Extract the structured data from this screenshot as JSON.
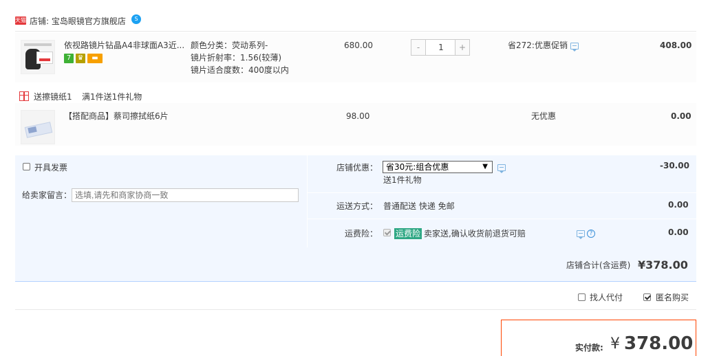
{
  "shop": {
    "badge": "天猫",
    "label": "店铺: 宝岛眼镜官方旗舰店",
    "wangwang_badge": "S"
  },
  "items": [
    {
      "title": "依视路镜片钻晶A4非球面A3近...",
      "attrs": [
        "颜色分类：荧动系列-",
        "镜片折射率：1.56(较薄)",
        "镜片适合度数：400度以内"
      ],
      "price": "680.00",
      "quantity": "1",
      "minus": "-",
      "plus": "+",
      "discount": "省272:优惠促销",
      "subtotal": "408.00",
      "tag_7": "7"
    },
    {
      "title": "【搭配商品】蔡司擦拭纸6片",
      "price": "98.00",
      "discount": "无优惠",
      "subtotal": "0.00"
    }
  ],
  "gift": {
    "name": "送擦镜纸1",
    "rule": "满1件送1件礼物"
  },
  "order": {
    "invoice_label": "开具发票",
    "message_label": "给卖家留言：",
    "message_placeholder": "选填,请先和商家协商一致",
    "coupon_label": "店铺优惠：",
    "coupon_selected": "省30元:组合优惠",
    "coupon_arrow": "▼",
    "coupon_gift": "送1件礼物",
    "coupon_amount": "-30.00",
    "shipping_label": "运送方式：",
    "shipping_value": "普通配送 快递 免邮",
    "shipping_amount": "0.00",
    "insurance_label": "运费险：",
    "insurance_badge": "运费险",
    "insurance_text": "卖家送,确认收货前退货可赔",
    "insurance_amount": "0.00",
    "help_glyph": "?"
  },
  "total": {
    "label": "店铺合计(含运费)",
    "amount": "¥378.00"
  },
  "options": {
    "pay_for_me": "找人代付",
    "anonymous": "匿名购买"
  },
  "pay": {
    "label": "实付款:",
    "currency": "¥",
    "amount": "378.00"
  },
  "colors": {
    "accent": "#ff4400",
    "panel_bg": "#f2f7ff",
    "insurance_green": "#2ea784"
  }
}
